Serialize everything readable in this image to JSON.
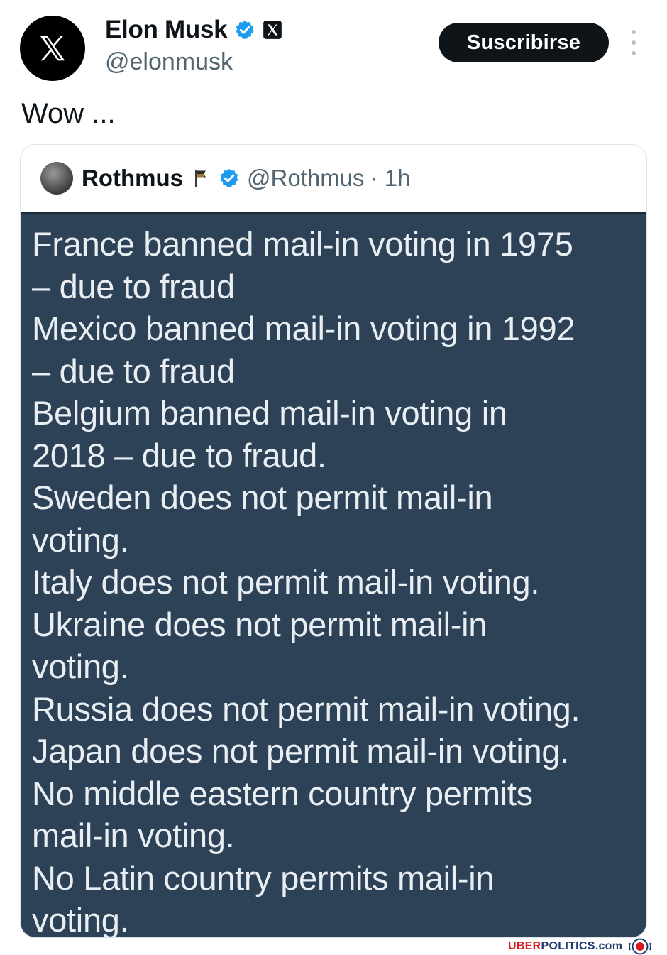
{
  "author": {
    "name": "Elon Musk",
    "handle": "@elonmusk",
    "avatar_icon": "x-logo-icon",
    "verified_icon": "verified-badge-icon",
    "affiliate_icon": "x-affiliate-icon"
  },
  "actions": {
    "subscribe_label": "Suscribirse",
    "more_icon": "more-vertical-icon"
  },
  "tweet": {
    "text": "Wow ..."
  },
  "quoted": {
    "name": "Rothmus",
    "flag_icon": "flag-icon",
    "verified_icon": "verified-badge-icon",
    "handle": "@Rothmus",
    "time": "· 1h",
    "lines": [
      "France banned mail-in voting in 1975",
      "– due to fraud",
      "Mexico banned mail-in voting in 1992",
      "– due to fraud",
      "Belgium banned mail-in voting in",
      "2018 – due to fraud.",
      "Sweden does not permit mail-in",
      "voting.",
      "Italy does not permit mail-in voting.",
      "Ukraine does not permit mail-in",
      "voting.",
      "Russia does not permit mail-in voting.",
      "Japan does not permit mail-in voting.",
      "No middle eastern country permits",
      "mail-in voting.",
      "No Latin country permits mail-in",
      "voting."
    ]
  },
  "watermark": {
    "part1": "UBER",
    "part2": "POLITICS.com"
  },
  "colors": {
    "accent_blue": "#1d9bf0",
    "image_background": "#2e4257",
    "watermark_red": "#d71920",
    "watermark_navy": "#1f3a6e"
  }
}
